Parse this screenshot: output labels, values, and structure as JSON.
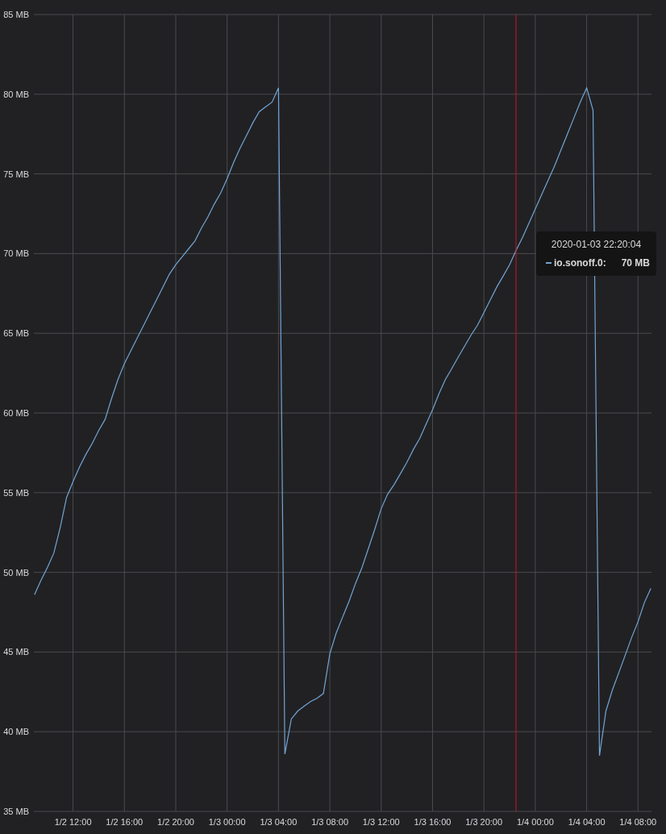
{
  "chart": {
    "chart_data": {
      "type": "line",
      "ylim": [
        35,
        85
      ],
      "yticks": [
        {
          "value": 35,
          "label": "35 MB"
        },
        {
          "value": 40,
          "label": "40 MB"
        },
        {
          "value": 45,
          "label": "45 MB"
        },
        {
          "value": 50,
          "label": "50 MB"
        },
        {
          "value": 55,
          "label": "55 MB"
        },
        {
          "value": 60,
          "label": "60 MB"
        },
        {
          "value": 65,
          "label": "65 MB"
        },
        {
          "value": 70,
          "label": "70 MB"
        },
        {
          "value": 75,
          "label": "75 MB"
        },
        {
          "value": 80,
          "label": "80 MB"
        },
        {
          "value": 85,
          "label": "85 MB"
        }
      ],
      "categories": [
        null,
        null,
        null,
        null,
        null,
        null,
        "1/2 12:00",
        null,
        null,
        null,
        null,
        null,
        null,
        null,
        "1/2 16:00",
        null,
        null,
        null,
        null,
        null,
        null,
        null,
        "1/2 20:00",
        null,
        null,
        null,
        null,
        null,
        null,
        null,
        "1/3 00:00",
        null,
        null,
        null,
        null,
        null,
        null,
        null,
        "1/3 04:00",
        null,
        null,
        null,
        null,
        null,
        null,
        null,
        "1/3 08:00",
        null,
        null,
        null,
        null,
        null,
        null,
        null,
        "1/3 12:00",
        null,
        null,
        null,
        null,
        null,
        null,
        null,
        "1/3 16:00",
        null,
        null,
        null,
        null,
        null,
        null,
        null,
        "1/3 20:00",
        null,
        null,
        null,
        null,
        null,
        null,
        null,
        "1/4 00:00",
        null,
        null,
        null,
        null,
        null,
        null,
        null,
        "1/4 04:00",
        null,
        null,
        null,
        null,
        null,
        null,
        null,
        "1/4 08:00",
        null,
        null
      ],
      "series": [
        {
          "color": "#73a5d4",
          "values": [
            48.6,
            49.5,
            50.3,
            51.2,
            52.8,
            54.7,
            55.7,
            56.6,
            57.4,
            58.1,
            58.9,
            59.6,
            60.9,
            62.1,
            63.1,
            63.9,
            64.7,
            65.5,
            66.3,
            67.1,
            67.9,
            68.7,
            69.3,
            69.8,
            70.3,
            70.8,
            71.6,
            72.3,
            73.1,
            73.8,
            74.7,
            75.7,
            76.6,
            77.4,
            78.2,
            78.9,
            79.2,
            79.5,
            80.4,
            38.6,
            40.8,
            41.3,
            41.6,
            41.9,
            42.1,
            42.4,
            44.9,
            46.2,
            47.2,
            48.2,
            49.3,
            50.3,
            51.5,
            52.7,
            54.0,
            54.9,
            55.5,
            56.2,
            56.9,
            57.7,
            58.4,
            59.3,
            60.2,
            61.2,
            62.1,
            62.8,
            63.5,
            64.2,
            64.9,
            65.5,
            66.3,
            67.1,
            67.9,
            68.6,
            69.3,
            70.2,
            71.0,
            71.9,
            72.8,
            73.7,
            74.6,
            75.5,
            76.5,
            77.5,
            78.5,
            79.5,
            80.4,
            79.0,
            38.5,
            41.3,
            42.6,
            43.7,
            44.8,
            45.9,
            46.9,
            48.1,
            49.0
          ]
        }
      ],
      "grid": true
    }
  },
  "tooltip": {
    "time": "2020-01-03 22:20:04",
    "series": "io.sonoff.0:",
    "value": "70 MB",
    "color": "#73a5d4"
  }
}
